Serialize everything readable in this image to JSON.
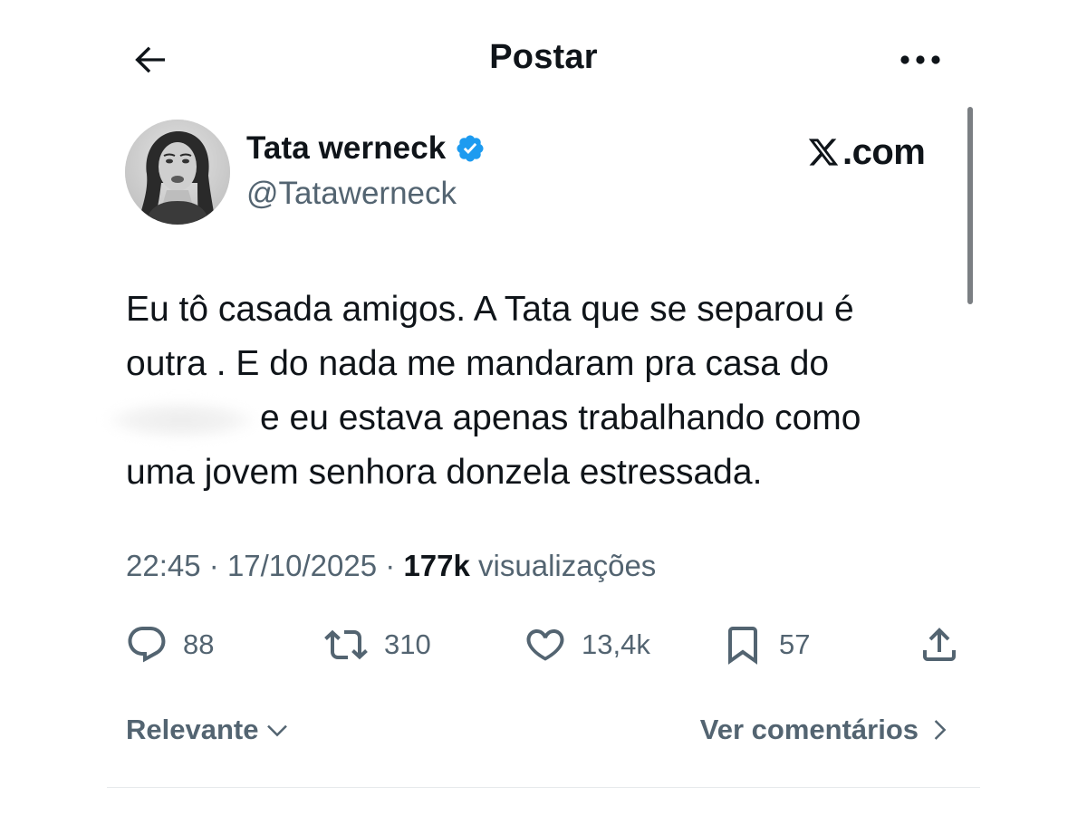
{
  "header": {
    "title": "Postar",
    "back_icon": "arrow-left-icon",
    "more_icon": "more-horizontal-icon"
  },
  "author": {
    "name": "Tata werneck",
    "handle": "@Tatawerneck",
    "verified": true,
    "verified_color": "#1d9bf0",
    "avatar_icon": "profile-photo"
  },
  "watermark": {
    "logo_icon": "x-logo-icon",
    "text": ".com"
  },
  "post": {
    "lines": [
      "Eu tô casada amigos. A Tata que se separou é",
      "outra . E do nada me mandaram pra casa do",
      "e eu estava apenas trabalhando como",
      "uma jovem senhora donzela estressada."
    ]
  },
  "meta": {
    "time": "22:45",
    "date": "17/10/2025",
    "views_count": "177k",
    "views_label": "visualizações",
    "separator": "·"
  },
  "actions": {
    "replies": "88",
    "reposts": "310",
    "likes": "13,4k",
    "bookmarks": "57"
  },
  "footer": {
    "sort_label": "Relevante",
    "comments_link": "Ver comentários"
  },
  "colors": {
    "text_primary": "#0f1419",
    "text_secondary": "#536471",
    "verified_blue": "#1d9bf0",
    "divider": "#e6e9eb"
  }
}
